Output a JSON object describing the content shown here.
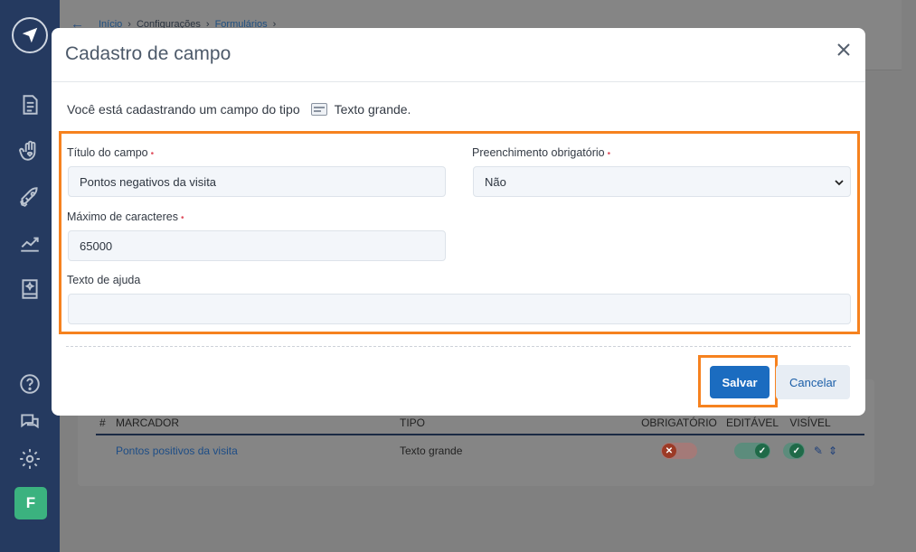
{
  "breadcrumb": {
    "home": "Início",
    "settings": "Configurações",
    "forms": "Formulários"
  },
  "user": {
    "initial": "F"
  },
  "modal": {
    "title": "Cadastro de campo",
    "intro_prefix": "Você está cadastrando um campo do tipo",
    "intro_type": "Texto grande.",
    "fields": {
      "title_label": "Título do campo",
      "title_value": "Pontos negativos da visita",
      "required_label": "Preenchimento obrigatório",
      "required_value": "Não",
      "maxchars_label": "Máximo de caracteres",
      "maxchars_value": "65000",
      "help_label": "Texto de ajuda",
      "help_value": ""
    },
    "required_marker": "•",
    "buttons": {
      "save": "Salvar",
      "cancel": "Cancelar"
    }
  },
  "table": {
    "headers": {
      "num": "#",
      "marker": "MARCADOR",
      "type": "TIPO",
      "required": "OBRIGATÓRIO",
      "editable": "EDITÁVEL",
      "visible": "VISÍVEL"
    },
    "rows": [
      {
        "marker": "Pontos positivos da visita",
        "type": "Texto grande",
        "required": false,
        "editable": true,
        "visible": true
      }
    ]
  },
  "colors": {
    "accent": "#f6821f",
    "primary": "#1b6cc0",
    "sidebar": "#253a60",
    "avatar": "#3bb27f"
  }
}
